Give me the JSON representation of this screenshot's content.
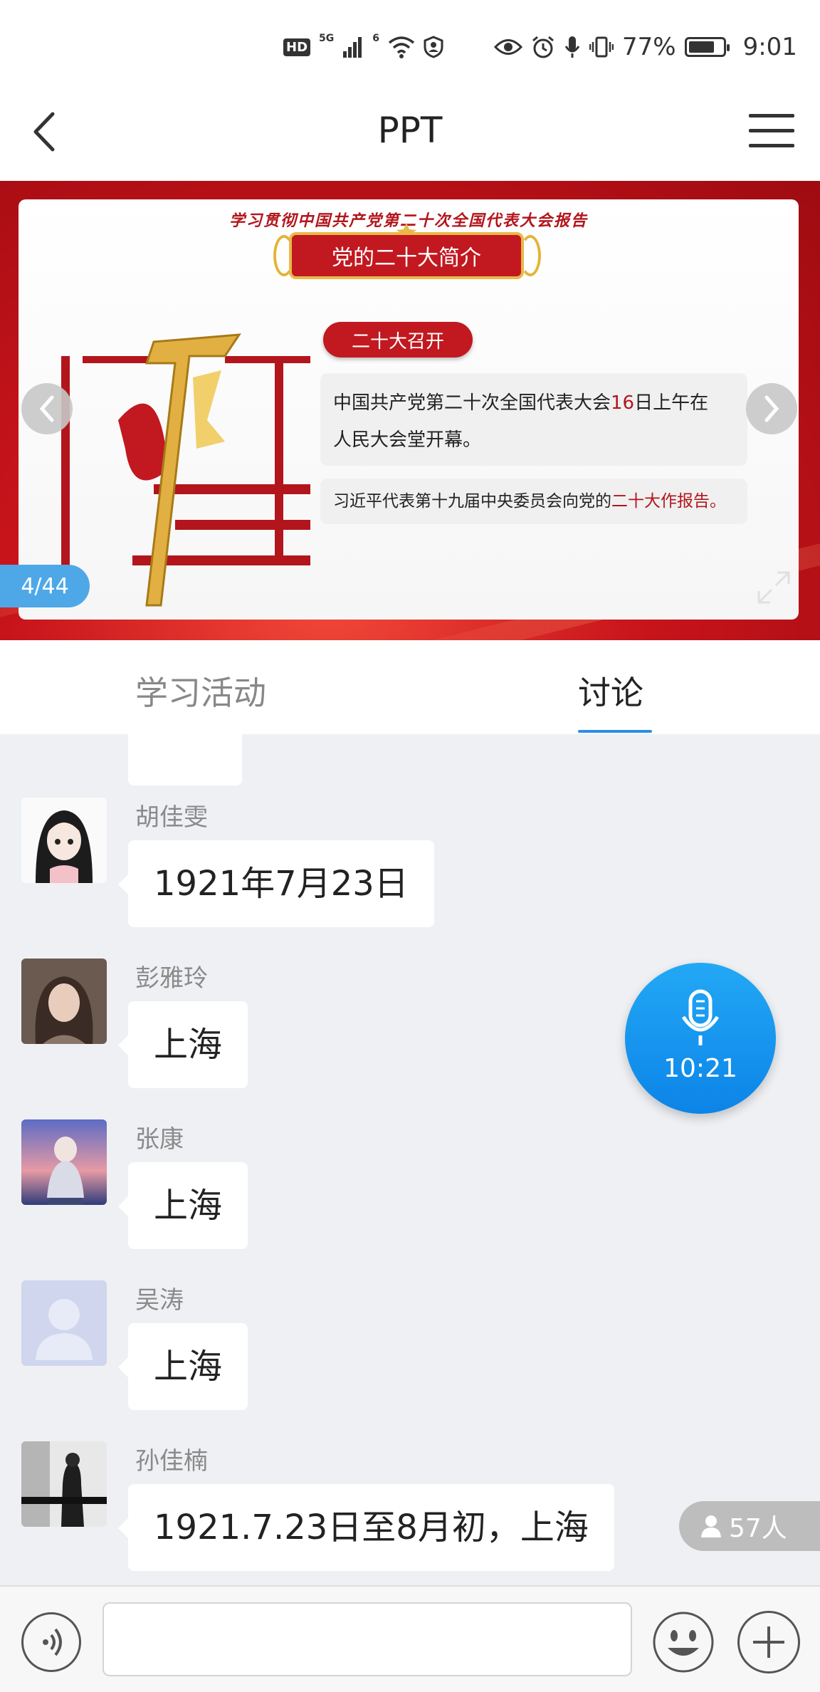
{
  "status_bar": {
    "hd": "HD",
    "sig1": "5G",
    "sig2": "6",
    "battery_percent_text": "77%",
    "battery_level": 0.77,
    "time": "9:01"
  },
  "header": {
    "title": "PPT"
  },
  "slide": {
    "top_text": "学习贯彻中国共产党第二十次全国代表大会报告",
    "banner": "党的二十大简介",
    "pill": "二十大召开",
    "text1_a": "中国共产党第二十次全国代表大会",
    "text1_b": "16",
    "text1_c": "日上午在",
    "text1_d": "人民大会堂开幕。",
    "text2_a": "习近平代表第十九届中央委员会向党的",
    "text2_b": "二十大作报告",
    "text2_c": "。",
    "page_indicator": "4/44"
  },
  "tabs": [
    {
      "label": "学习活动",
      "active": false
    },
    {
      "label": "讨论",
      "active": true
    }
  ],
  "messages": [
    {
      "name": "胡佳雯",
      "text": "1921年7月23日"
    },
    {
      "name": "彭雅玲",
      "text": "上海"
    },
    {
      "name": "张康",
      "text": "上海"
    },
    {
      "name": "吴涛",
      "text": "上海"
    },
    {
      "name": "孙佳楠",
      "text": "1921.7.23日至8月初，上海"
    }
  ],
  "mic_float": {
    "time": "10:21"
  },
  "participants": {
    "count": "57人"
  },
  "colors": {
    "accent": "#2e8de6",
    "party_red": "#c21820"
  }
}
